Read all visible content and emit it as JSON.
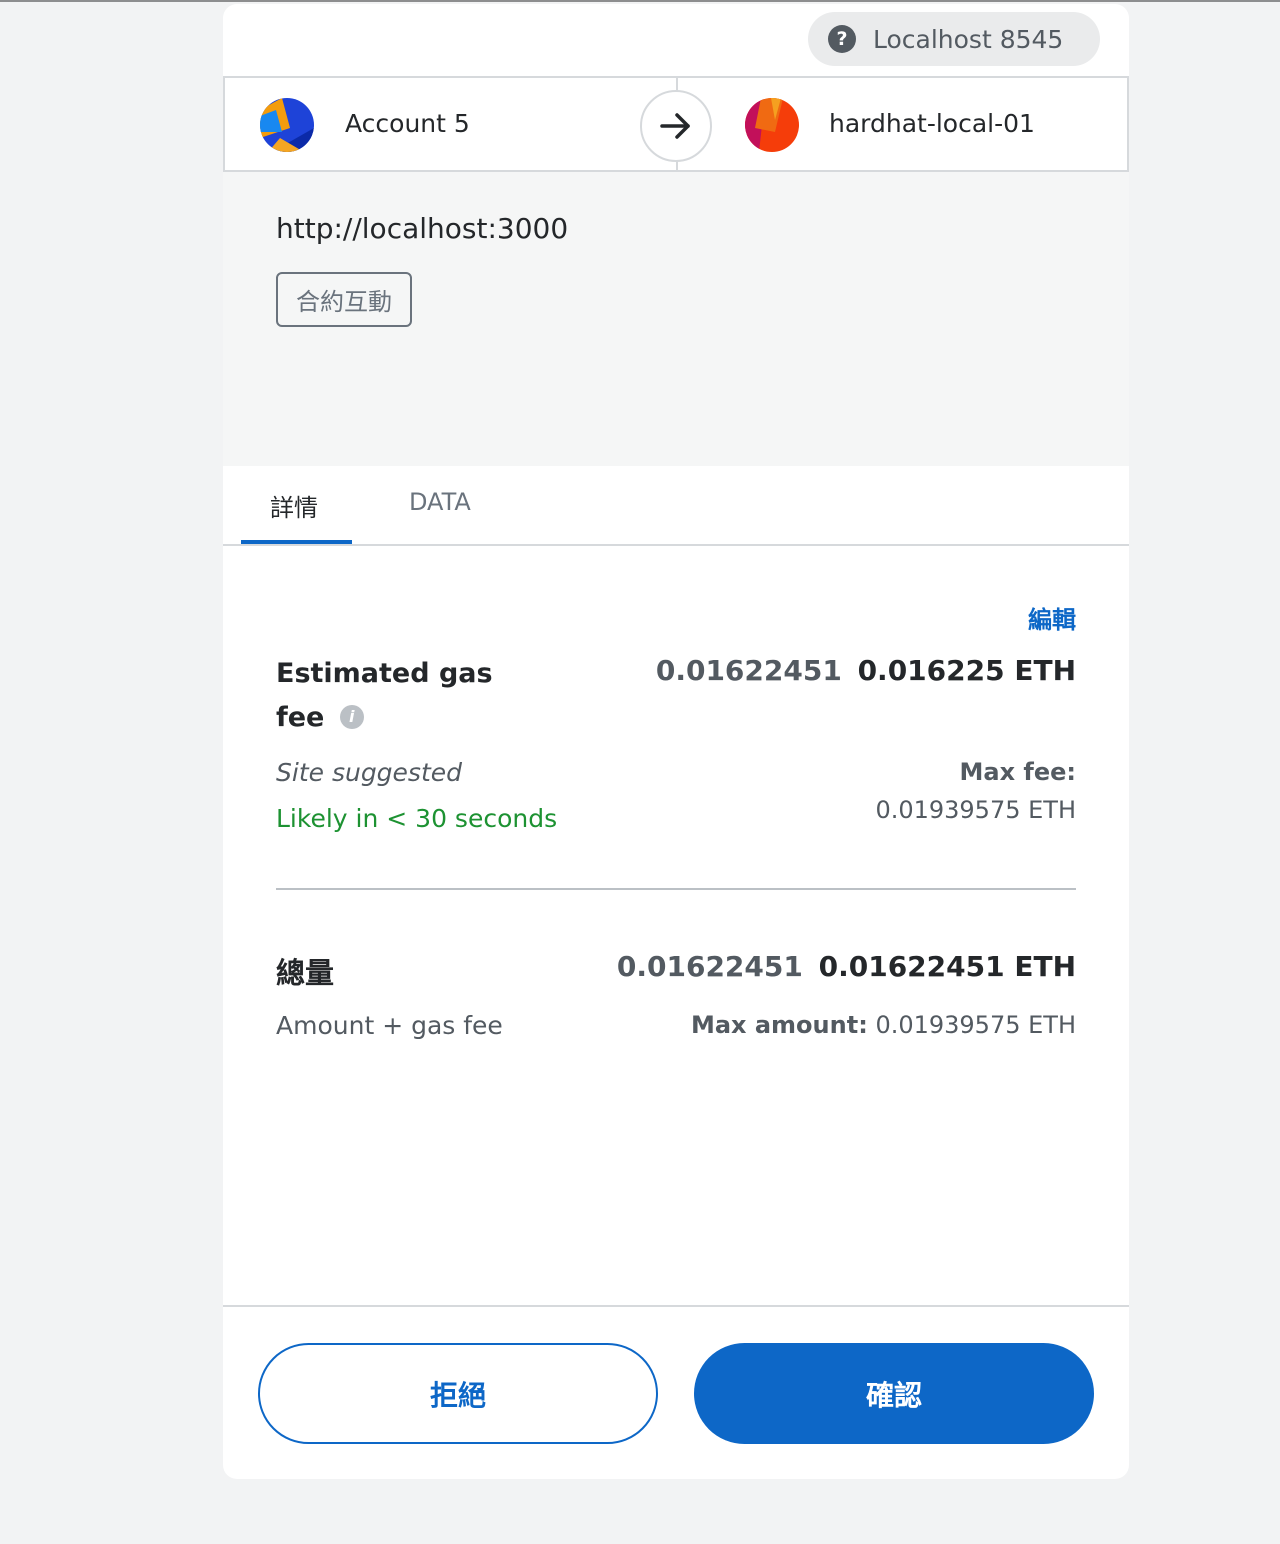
{
  "network": {
    "label": "Localhost 8545",
    "icon": "question-icon"
  },
  "sender": {
    "name": "Account 5"
  },
  "recipient": {
    "name": "hardhat-local-01"
  },
  "origin": {
    "url": "http://localhost:3000",
    "method": "合約互動"
  },
  "tabs": [
    {
      "label": "詳情",
      "active": true
    },
    {
      "label": "DATA",
      "active": false
    }
  ],
  "gas": {
    "edit_label": "編輯",
    "label": "Estimated gas fee",
    "label_line1": "Estimated gas",
    "label_line2": "fee",
    "value_secondary": "0.01622451",
    "value_primary": "0.016225 ETH",
    "suggestion": "Site suggested",
    "timing": "Likely in < 30 seconds",
    "max_fee_label": "Max fee:",
    "max_fee_value": "0.01939575 ETH"
  },
  "total": {
    "label": "總量",
    "value_secondary": "0.01622451",
    "value_primary": "0.01622451 ETH",
    "subtitle": "Amount + gas fee",
    "max_amount_label": "Max amount:",
    "max_amount_value": "0.01939575 ETH"
  },
  "buttons": {
    "reject": "拒絕",
    "confirm": "確認"
  },
  "colors": {
    "accent": "#0d67c7",
    "success": "#1d9232",
    "text": "#24272a",
    "muted": "#535a61"
  }
}
